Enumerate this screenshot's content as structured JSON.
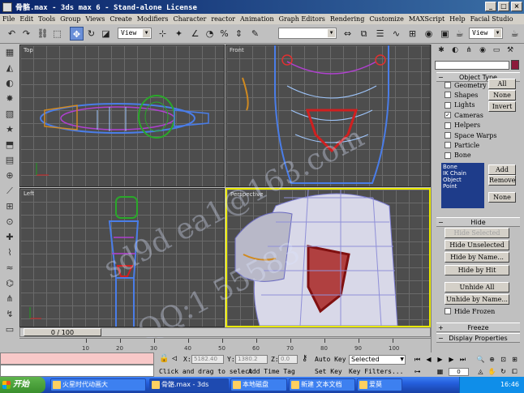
{
  "window": {
    "title": "骨骼.max - 3ds max 6 - Stand-alone License",
    "min": "_",
    "max": "□",
    "close": "×"
  },
  "menu": [
    "File",
    "Edit",
    "Tools",
    "Group",
    "Views",
    "Create",
    "Modifiers",
    "Character",
    "reactor",
    "Animation",
    "Graph Editors",
    "Rendering",
    "Customize",
    "MAXScript",
    "Help",
    "Facial Studio"
  ],
  "toolbar": {
    "ref_coord": "View",
    "view_right": "View"
  },
  "viewports": {
    "top": "Top",
    "front": "Front",
    "left": "Left",
    "perspective": "Perspective"
  },
  "timeline": {
    "frame_display": "0 / 100",
    "ticks": [
      "10",
      "20",
      "30",
      "40",
      "50",
      "60",
      "70",
      "80",
      "90",
      "100"
    ]
  },
  "status": {
    "x_label": "X:",
    "x_value": "5182.40",
    "y_label": "Y:",
    "y_value": "1380.2",
    "z_label": "Z:",
    "z_value": "0.0",
    "auto_key": "Auto Key",
    "selected": "Selected",
    "set_key": "Set Key",
    "key_filters": "Key Filters...",
    "prompt": "Click and drag to select",
    "add_time_tag": "Add Time Tag",
    "frame": "0"
  },
  "command_panel": {
    "object_type_title": "Object Type",
    "categories": [
      "Geometry",
      "Shapes",
      "Lights",
      "Cameras",
      "Helpers",
      "Space Warps",
      "Particle",
      "Bone"
    ],
    "categories_checked": [
      false,
      false,
      false,
      true,
      false,
      false,
      false,
      false
    ],
    "all_btn": "All",
    "none_btn": "None",
    "invert_btn": "Invert",
    "list_items": [
      "Bone",
      "IK Chain Object",
      "Point"
    ],
    "add_btn": "Add",
    "remove_btn": "Remove",
    "none2_btn": "None",
    "hide_title": "Hide",
    "hide_selected": "Hide Selected",
    "hide_unselected": "Hide Unselected",
    "hide_by_name": "Hide by Name...",
    "hide_by_hit": "Hide by Hit",
    "unhide_all": "Unhide All",
    "unhide_by_name": "Unhide by Name...",
    "hide_frozen": "Hide Frozen",
    "freeze_title": "Freeze",
    "display_props_title": "Display Properties"
  },
  "taskbar": {
    "start": "开始",
    "tasks": [
      "火星时代动画大",
      "骨骼.max - 3ds",
      "本地磁盘",
      "新建 文本文档",
      "爱莫"
    ],
    "time": "16:46"
  },
  "watermark": {
    "line1": "sd9d ea1@163.com",
    "line2": "QQ:1  55583"
  },
  "colors": {
    "title_bar": "#0a246a",
    "viewport_bg": "#4d4d4d",
    "active_border": "#e8e800",
    "taskbar": "#245edc"
  }
}
